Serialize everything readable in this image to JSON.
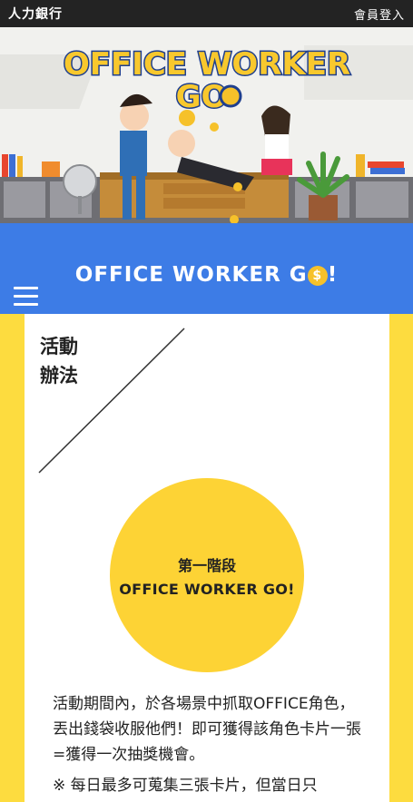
{
  "header": {
    "brand": "人力銀行",
    "login_label": "會員登入"
  },
  "hero": {
    "logo_line1": "OFFICE WORKER",
    "logo_line2": "GO"
  },
  "banner": {
    "title_text": "OFFICE WORKER G",
    "title_coin": "$",
    "title_suffix": "!",
    "menu_icon": "hamburger-menu-icon"
  },
  "section": {
    "title_line1": "活動",
    "title_line2": "辦法"
  },
  "stage": {
    "label": "第一階段",
    "name": "OFFICE WORKER GO!"
  },
  "content": {
    "description": "活動期間內，於各場景中抓取OFFICE角色，丟出錢袋收服他們！即可獲得該角色卡片一張=獲得一次抽獎機會。",
    "note": "※ 每日最多可蒐集三張卡片，但當日只"
  },
  "colors": {
    "topbar": "#232323",
    "blue": "#3d7ce6",
    "yellow": "#fddc3f",
    "circle": "#fdd335"
  }
}
